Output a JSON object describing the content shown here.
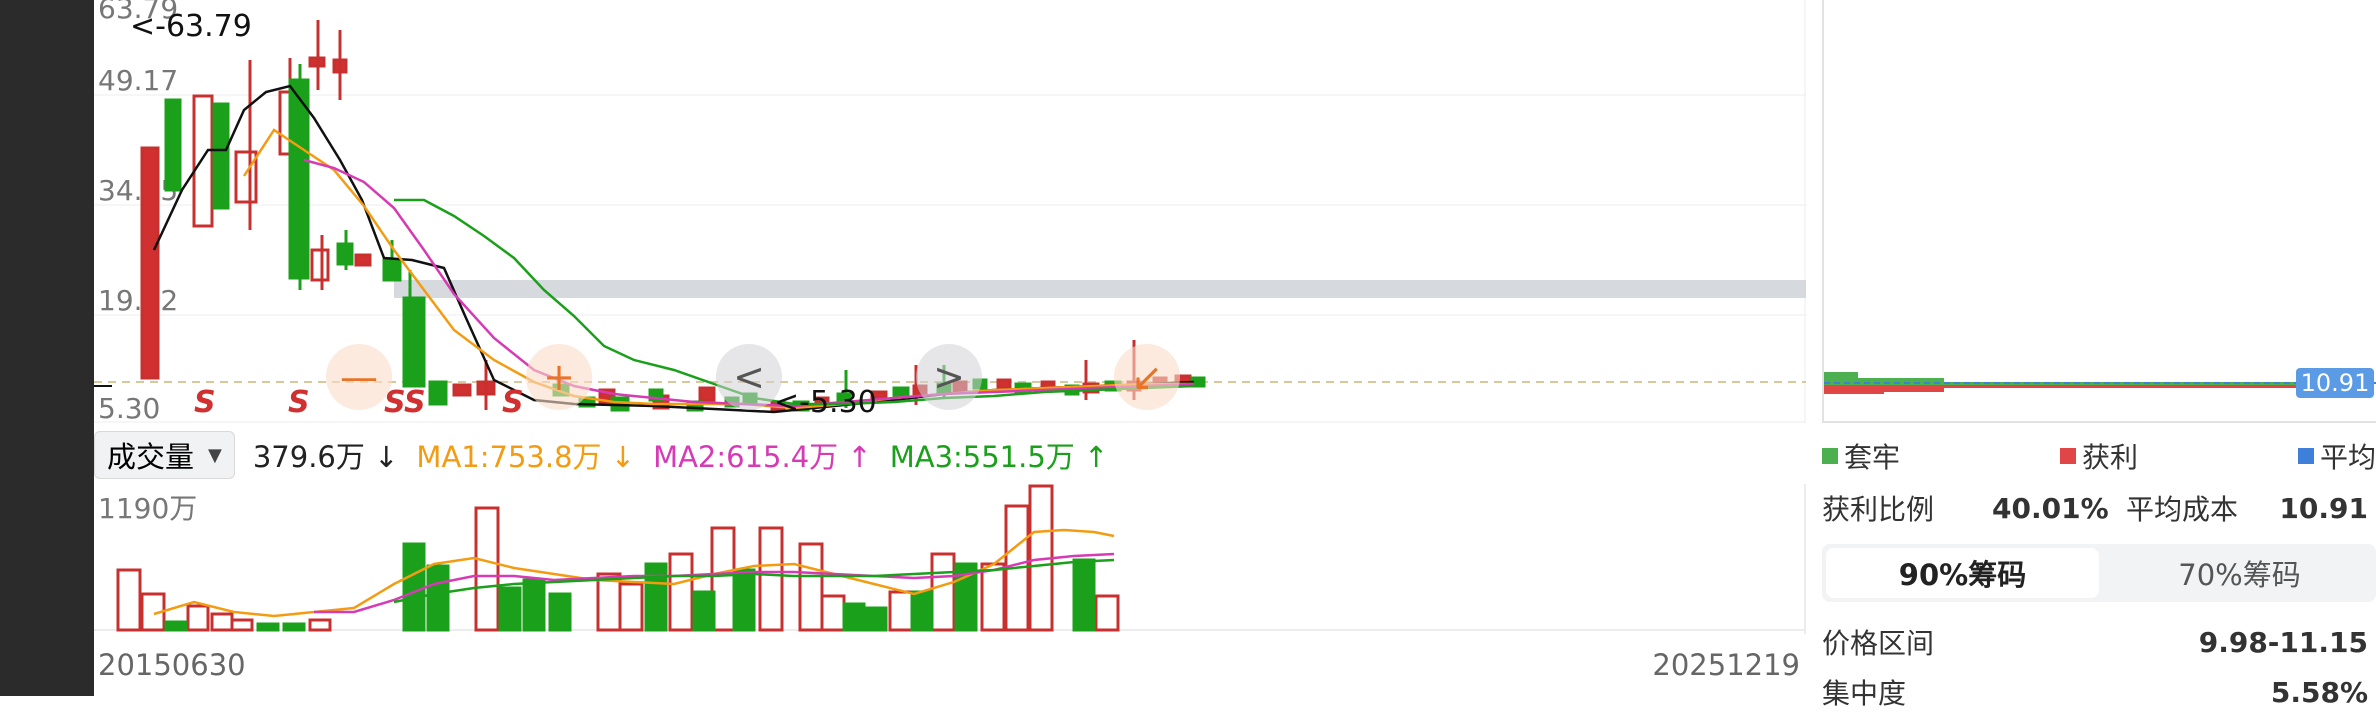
{
  "price_chart": {
    "y_labels": [
      "63.79",
      "49.17",
      "34.55",
      "19.92",
      "5.30"
    ],
    "annotations": {
      "high": "<-63.79",
      "low": "<-5.30"
    },
    "s_markers": [
      "S",
      "S",
      "S",
      "S",
      "S"
    ],
    "ma_colors": {
      "black": "#111111",
      "orange": "#f39c12",
      "magenta": "#d63ab5",
      "green": "#1aa01a"
    },
    "rise_color": "#d0302f",
    "fall_color": "#1aa01a"
  },
  "controls": {
    "zoom_out_symbol": "—",
    "zoom_in_symbol": "+",
    "prev_symbol": "<",
    "next_symbol": ">",
    "collapse_symbol": "↙"
  },
  "volume_row": {
    "select_label": "成交量",
    "vol": "379.6万",
    "vol_arrow": "↓",
    "ma1": "MA1:753.8万",
    "ma1_arrow": "↓",
    "ma2": "MA2:615.4万",
    "ma2_arrow": "↑",
    "ma3": "MA3:551.5万",
    "ma3_arrow": "↑",
    "colors": {
      "ma1": "#f39c12",
      "ma2": "#d63ab5",
      "ma3": "#1aa01a"
    }
  },
  "volume_chart": {
    "max_label": "1190万"
  },
  "dates": {
    "start": "20150630",
    "end": "20251219"
  },
  "chips": {
    "price_tag": "10.91",
    "legend": [
      {
        "label": "套牢",
        "color": "#4caf50"
      },
      {
        "label": "获利",
        "color": "#e04646"
      },
      {
        "label": "平均",
        "color": "#3d7fd9"
      }
    ],
    "profit_ratio_label": "获利比例",
    "profit_ratio_value": "40.01%",
    "avg_cost_label": "平均成本",
    "avg_cost_value": "10.91",
    "tabs": [
      "90%筹码",
      "70%筹码"
    ],
    "price_range_label": "价格区间",
    "price_range_value": "9.98-11.15",
    "concentration_label": "集中度",
    "concentration_value": "5.58%"
  }
}
